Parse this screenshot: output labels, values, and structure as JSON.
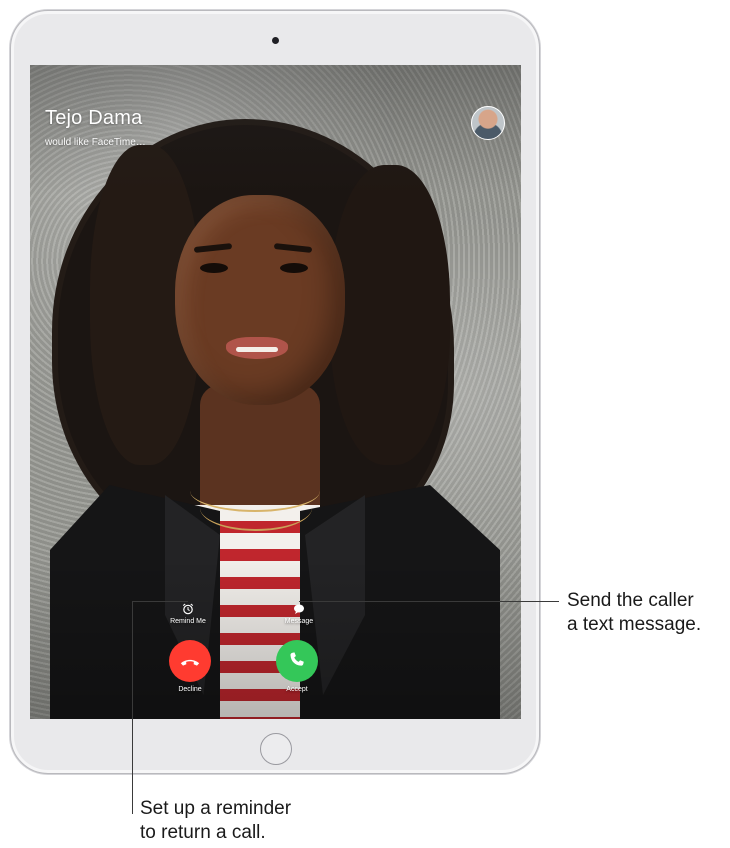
{
  "call": {
    "caller_name": "Tejo Dama",
    "status_text": "would like FaceTime…",
    "avatar_icon": "contact-photo",
    "remind_label": "Remind Me",
    "message_label": "Message",
    "decline_label": "Decline",
    "accept_label": "Accept",
    "decline_color": "#ff3b30",
    "accept_color": "#34c759"
  },
  "callouts": {
    "message": {
      "line1": "Send the caller",
      "line2": "a text message."
    },
    "reminder": {
      "line1": "Set up a reminder",
      "line2": "to return a call."
    }
  },
  "icons": {
    "remind": "alarm-clock-icon",
    "message": "speech-bubble-icon",
    "decline": "phone-down-icon",
    "accept": "phone-icon",
    "home": "home-button"
  }
}
